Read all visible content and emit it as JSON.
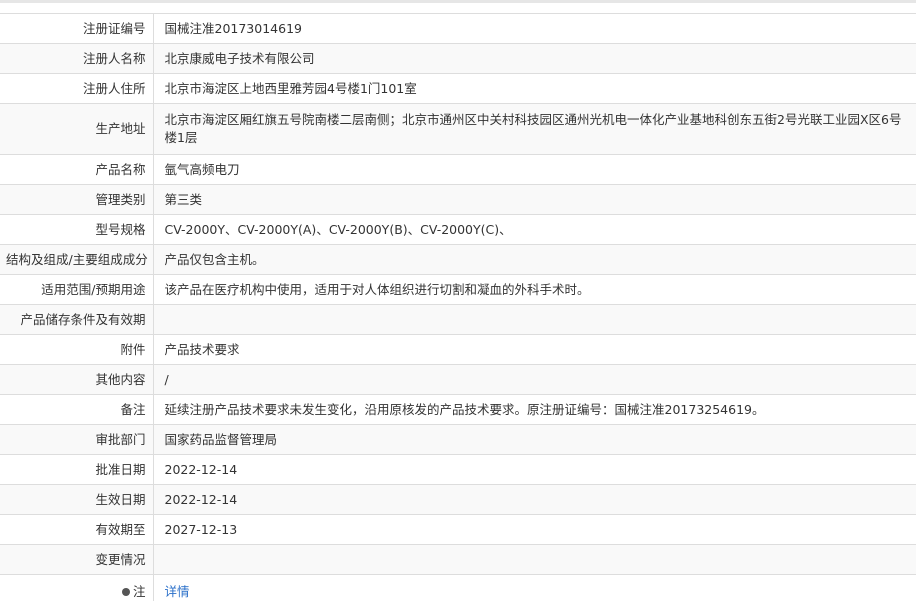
{
  "rows": [
    {
      "label": "注册证编号",
      "value": "国械注准20173014619"
    },
    {
      "label": "注册人名称",
      "value": "北京康威电子技术有限公司"
    },
    {
      "label": "注册人住所",
      "value": "北京市海淀区上地西里雅芳园4号楼1门101室"
    },
    {
      "label": "生产地址",
      "value": "北京市海淀区厢红旗五号院南楼二层南侧；北京市通州区中关村科技园区通州光机电一体化产业基地科创东五街2号光联工业园X区6号楼1层"
    },
    {
      "label": "产品名称",
      "value": "氩气高频电刀"
    },
    {
      "label": "管理类别",
      "value": "第三类"
    },
    {
      "label": "型号规格",
      "value": "CV-2000Y、CV-2000Y(A)、CV-2000Y(B)、CV-2000Y(C)、"
    },
    {
      "label": "结构及组成/主要组成成分",
      "value": "产品仅包含主机。"
    },
    {
      "label": "适用范围/预期用途",
      "value": "该产品在医疗机构中使用，适用于对人体组织进行切割和凝血的外科手术时。"
    },
    {
      "label": "产品储存条件及有效期",
      "value": ""
    },
    {
      "label": "附件",
      "value": "产品技术要求"
    },
    {
      "label": "其他内容",
      "value": "/"
    },
    {
      "label": "备注",
      "value": "延续注册产品技术要求未发生变化，沿用原核发的产品技术要求。原注册证编号：国械注准20173254619。"
    },
    {
      "label": "审批部门",
      "value": "国家药品监督管理局"
    },
    {
      "label": "批准日期",
      "value": "2022-12-14"
    },
    {
      "label": "生效日期",
      "value": "2022-12-14"
    },
    {
      "label": "有效期至",
      "value": "2027-12-13"
    },
    {
      "label": "变更情况",
      "value": ""
    }
  ],
  "note": {
    "label": "注",
    "link_text": "详情"
  }
}
